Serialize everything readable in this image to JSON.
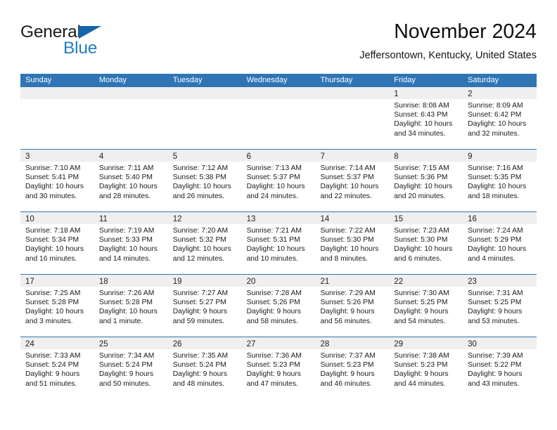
{
  "brand": {
    "name_part1": "General",
    "name_part2": "Blue",
    "flag_icon": "blue-triangle-flag-icon"
  },
  "header": {
    "title": "November 2024",
    "subtitle": "Jeffersontown, Kentucky, United States"
  },
  "colors": {
    "header_blue": "#2f75b5",
    "brand_blue": "#1f7ec4",
    "daynum_band": "#efefef",
    "cell_background": "#ffffff"
  },
  "calendar": {
    "weekdays": [
      "Sunday",
      "Monday",
      "Tuesday",
      "Wednesday",
      "Thursday",
      "Friday",
      "Saturday"
    ],
    "weeks": [
      [
        {
          "day": "",
          "empty": true
        },
        {
          "day": "",
          "empty": true
        },
        {
          "day": "",
          "empty": true
        },
        {
          "day": "",
          "empty": true
        },
        {
          "day": "",
          "empty": true
        },
        {
          "day": "1",
          "sunrise": "Sunrise: 8:08 AM",
          "sunset": "Sunset: 6:43 PM",
          "daylight_line1": "Daylight: 10 hours",
          "daylight_line2": "and 34 minutes."
        },
        {
          "day": "2",
          "sunrise": "Sunrise: 8:09 AM",
          "sunset": "Sunset: 6:42 PM",
          "daylight_line1": "Daylight: 10 hours",
          "daylight_line2": "and 32 minutes."
        }
      ],
      [
        {
          "day": "3",
          "sunrise": "Sunrise: 7:10 AM",
          "sunset": "Sunset: 5:41 PM",
          "daylight_line1": "Daylight: 10 hours",
          "daylight_line2": "and 30 minutes."
        },
        {
          "day": "4",
          "sunrise": "Sunrise: 7:11 AM",
          "sunset": "Sunset: 5:40 PM",
          "daylight_line1": "Daylight: 10 hours",
          "daylight_line2": "and 28 minutes."
        },
        {
          "day": "5",
          "sunrise": "Sunrise: 7:12 AM",
          "sunset": "Sunset: 5:38 PM",
          "daylight_line1": "Daylight: 10 hours",
          "daylight_line2": "and 26 minutes."
        },
        {
          "day": "6",
          "sunrise": "Sunrise: 7:13 AM",
          "sunset": "Sunset: 5:37 PM",
          "daylight_line1": "Daylight: 10 hours",
          "daylight_line2": "and 24 minutes."
        },
        {
          "day": "7",
          "sunrise": "Sunrise: 7:14 AM",
          "sunset": "Sunset: 5:37 PM",
          "daylight_line1": "Daylight: 10 hours",
          "daylight_line2": "and 22 minutes."
        },
        {
          "day": "8",
          "sunrise": "Sunrise: 7:15 AM",
          "sunset": "Sunset: 5:36 PM",
          "daylight_line1": "Daylight: 10 hours",
          "daylight_line2": "and 20 minutes."
        },
        {
          "day": "9",
          "sunrise": "Sunrise: 7:16 AM",
          "sunset": "Sunset: 5:35 PM",
          "daylight_line1": "Daylight: 10 hours",
          "daylight_line2": "and 18 minutes."
        }
      ],
      [
        {
          "day": "10",
          "sunrise": "Sunrise: 7:18 AM",
          "sunset": "Sunset: 5:34 PM",
          "daylight_line1": "Daylight: 10 hours",
          "daylight_line2": "and 16 minutes."
        },
        {
          "day": "11",
          "sunrise": "Sunrise: 7:19 AM",
          "sunset": "Sunset: 5:33 PM",
          "daylight_line1": "Daylight: 10 hours",
          "daylight_line2": "and 14 minutes."
        },
        {
          "day": "12",
          "sunrise": "Sunrise: 7:20 AM",
          "sunset": "Sunset: 5:32 PM",
          "daylight_line1": "Daylight: 10 hours",
          "daylight_line2": "and 12 minutes."
        },
        {
          "day": "13",
          "sunrise": "Sunrise: 7:21 AM",
          "sunset": "Sunset: 5:31 PM",
          "daylight_line1": "Daylight: 10 hours",
          "daylight_line2": "and 10 minutes."
        },
        {
          "day": "14",
          "sunrise": "Sunrise: 7:22 AM",
          "sunset": "Sunset: 5:30 PM",
          "daylight_line1": "Daylight: 10 hours",
          "daylight_line2": "and 8 minutes."
        },
        {
          "day": "15",
          "sunrise": "Sunrise: 7:23 AM",
          "sunset": "Sunset: 5:30 PM",
          "daylight_line1": "Daylight: 10 hours",
          "daylight_line2": "and 6 minutes."
        },
        {
          "day": "16",
          "sunrise": "Sunrise: 7:24 AM",
          "sunset": "Sunset: 5:29 PM",
          "daylight_line1": "Daylight: 10 hours",
          "daylight_line2": "and 4 minutes."
        }
      ],
      [
        {
          "day": "17",
          "sunrise": "Sunrise: 7:25 AM",
          "sunset": "Sunset: 5:28 PM",
          "daylight_line1": "Daylight: 10 hours",
          "daylight_line2": "and 3 minutes."
        },
        {
          "day": "18",
          "sunrise": "Sunrise: 7:26 AM",
          "sunset": "Sunset: 5:28 PM",
          "daylight_line1": "Daylight: 10 hours",
          "daylight_line2": "and 1 minute."
        },
        {
          "day": "19",
          "sunrise": "Sunrise: 7:27 AM",
          "sunset": "Sunset: 5:27 PM",
          "daylight_line1": "Daylight: 9 hours",
          "daylight_line2": "and 59 minutes."
        },
        {
          "day": "20",
          "sunrise": "Sunrise: 7:28 AM",
          "sunset": "Sunset: 5:26 PM",
          "daylight_line1": "Daylight: 9 hours",
          "daylight_line2": "and 58 minutes."
        },
        {
          "day": "21",
          "sunrise": "Sunrise: 7:29 AM",
          "sunset": "Sunset: 5:26 PM",
          "daylight_line1": "Daylight: 9 hours",
          "daylight_line2": "and 56 minutes."
        },
        {
          "day": "22",
          "sunrise": "Sunrise: 7:30 AM",
          "sunset": "Sunset: 5:25 PM",
          "daylight_line1": "Daylight: 9 hours",
          "daylight_line2": "and 54 minutes."
        },
        {
          "day": "23",
          "sunrise": "Sunrise: 7:31 AM",
          "sunset": "Sunset: 5:25 PM",
          "daylight_line1": "Daylight: 9 hours",
          "daylight_line2": "and 53 minutes."
        }
      ],
      [
        {
          "day": "24",
          "sunrise": "Sunrise: 7:33 AM",
          "sunset": "Sunset: 5:24 PM",
          "daylight_line1": "Daylight: 9 hours",
          "daylight_line2": "and 51 minutes."
        },
        {
          "day": "25",
          "sunrise": "Sunrise: 7:34 AM",
          "sunset": "Sunset: 5:24 PM",
          "daylight_line1": "Daylight: 9 hours",
          "daylight_line2": "and 50 minutes."
        },
        {
          "day": "26",
          "sunrise": "Sunrise: 7:35 AM",
          "sunset": "Sunset: 5:24 PM",
          "daylight_line1": "Daylight: 9 hours",
          "daylight_line2": "and 48 minutes."
        },
        {
          "day": "27",
          "sunrise": "Sunrise: 7:36 AM",
          "sunset": "Sunset: 5:23 PM",
          "daylight_line1": "Daylight: 9 hours",
          "daylight_line2": "and 47 minutes."
        },
        {
          "day": "28",
          "sunrise": "Sunrise: 7:37 AM",
          "sunset": "Sunset: 5:23 PM",
          "daylight_line1": "Daylight: 9 hours",
          "daylight_line2": "and 46 minutes."
        },
        {
          "day": "29",
          "sunrise": "Sunrise: 7:38 AM",
          "sunset": "Sunset: 5:23 PM",
          "daylight_line1": "Daylight: 9 hours",
          "daylight_line2": "and 44 minutes."
        },
        {
          "day": "30",
          "sunrise": "Sunrise: 7:39 AM",
          "sunset": "Sunset: 5:22 PM",
          "daylight_line1": "Daylight: 9 hours",
          "daylight_line2": "and 43 minutes."
        }
      ]
    ]
  }
}
